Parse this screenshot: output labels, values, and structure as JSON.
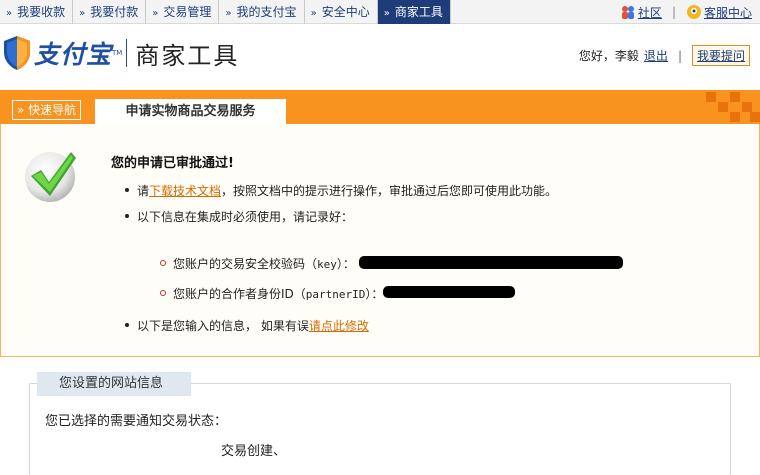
{
  "topnav": {
    "tabs": [
      {
        "label": "我要收款"
      },
      {
        "label": "我要付款"
      },
      {
        "label": "交易管理"
      },
      {
        "label": "我的支付宝"
      },
      {
        "label": "安全中心"
      },
      {
        "label": "商家工具"
      }
    ],
    "community_label": "社区",
    "service_label": "客服中心"
  },
  "header": {
    "logo_text": "支付宝",
    "logo_tm": "TM",
    "product_title": "商家工具",
    "greeting": "您好，李毅",
    "logout_label": "退出",
    "ask_label": "我要提问"
  },
  "band": {
    "quick_nav_label": "» 快速导航",
    "service_tab_label": "申请实物商品交易服务"
  },
  "approval": {
    "heading": "您的申请已审批通过!",
    "bullet1_prefix": "请",
    "bullet1_link": "下载技术文档",
    "bullet1_suffix": "，按照文档中的提示进行操作，审批通过后您即可使用此功能。",
    "bullet2": "以下信息在集成时必须使用，请记录好：",
    "key_prefix": "您账户的交易安全校验码（",
    "key_code": "key",
    "key_suffix": "）：",
    "partner_prefix": "您账户的合作者身份ID（",
    "partner_code": "partnerID",
    "partner_suffix": "）：",
    "bullet3_text": "以下是您输入的信息，  如果有误",
    "bullet3_link": "请点此修改"
  },
  "site_info": {
    "title": "您设置的网站信息",
    "notify_label": "您已选择的需要通知交易状态：",
    "notify_value": "交易创建、"
  },
  "colors": {
    "nav_active": "#1d3c79",
    "brand_orange": "#f7931e",
    "link_orange": "#d66b00",
    "brand_blue": "#1e4fa3"
  }
}
